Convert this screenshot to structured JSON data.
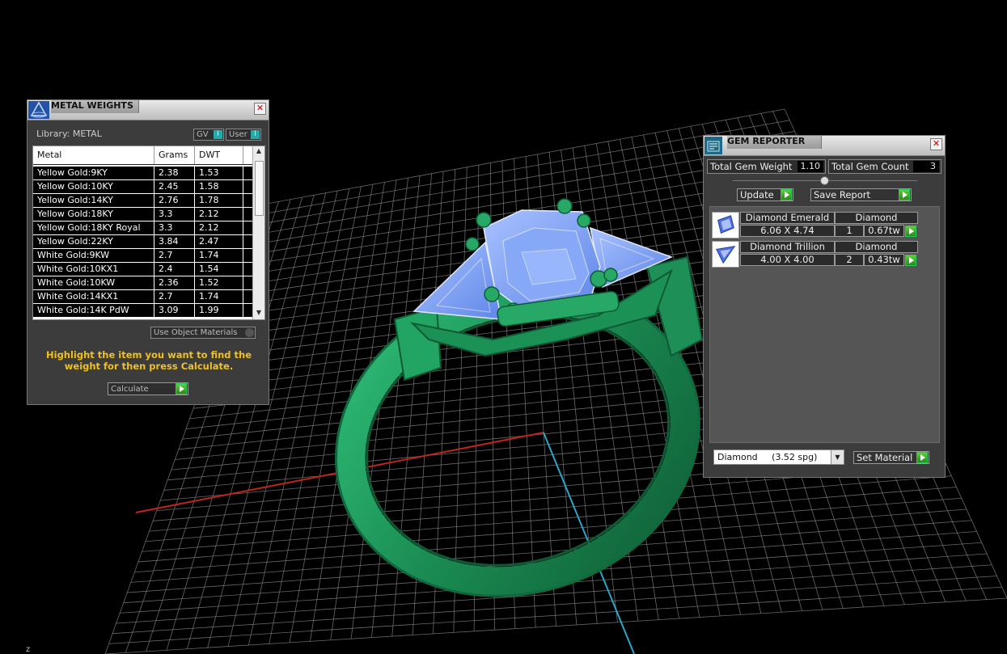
{
  "metal_weights": {
    "title": "METAL WEIGHTS",
    "library_label": "Library: METAL",
    "gv_label": "GV",
    "user_label": "User",
    "toggle_glyph": "I",
    "columns": [
      "Metal",
      "Grams",
      "DWT"
    ],
    "rows": [
      [
        "Yellow Gold:9KY",
        "2.38",
        "1.53"
      ],
      [
        "Yellow Gold:10KY",
        "2.45",
        "1.58"
      ],
      [
        "Yellow Gold:14KY",
        "2.76",
        "1.78"
      ],
      [
        "Yellow Gold:18KY",
        "3.3",
        "2.12"
      ],
      [
        "Yellow Gold:18KY Royal",
        "3.3",
        "2.12"
      ],
      [
        "Yellow Gold:22KY",
        "3.84",
        "2.47"
      ],
      [
        "White Gold:9KW",
        "2.7",
        "1.74"
      ],
      [
        "White Gold:10KX1",
        "2.4",
        "1.54"
      ],
      [
        "White Gold:10KW",
        "2.36",
        "1.52"
      ],
      [
        "White Gold:14KX1",
        "2.7",
        "1.74"
      ],
      [
        "White Gold:14K PdW",
        "3.09",
        "1.99"
      ]
    ],
    "use_object_materials": "Use Object Materials",
    "hint": "Highlight the item you want to find the weight for then press Calculate.",
    "calculate_label": "Calculate",
    "close_glyph": "✕"
  },
  "gem_reporter": {
    "title": "GEM REPORTER",
    "total_weight_label": "Total Gem Weight",
    "total_weight_value": "1.10",
    "total_count_label": "Total Gem Count",
    "total_count_value": "3",
    "update_label": "Update",
    "save_report_label": "Save Report",
    "gems": [
      {
        "name": "Diamond Emerald",
        "material": "Diamond",
        "size": "6.06 X 4.74",
        "count": "1",
        "weight": "0.67tw",
        "icon": "emerald-cut-gem-icon"
      },
      {
        "name": "Diamond Trillion",
        "material": "Diamond",
        "size": "4.00 X 4.00",
        "count": "2",
        "weight": "0.43tw",
        "icon": "trillion-cut-gem-icon"
      }
    ],
    "material_select": "Diamond     (3.52 spg)",
    "set_material_label": "Set Material",
    "close_glyph": "✕"
  },
  "viewport": {
    "axis_label": "z",
    "colors": {
      "grid": "#8a8a8a",
      "ring": "#1f9a5c",
      "stone": "#7aa2ff",
      "x_axis": "#c0241c",
      "y_axis": "#2aa6c8"
    }
  }
}
